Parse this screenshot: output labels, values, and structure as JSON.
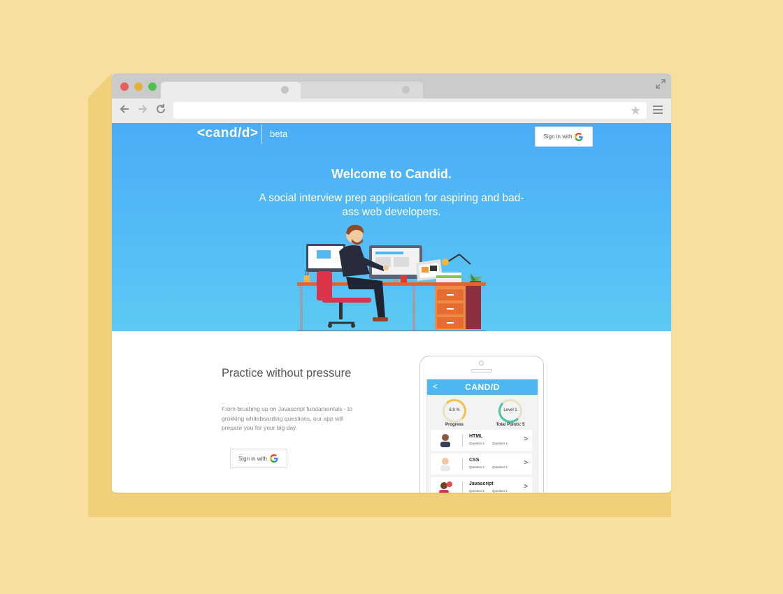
{
  "browser": {
    "dot_colors": [
      "#e5605b",
      "#e2b33c",
      "#4fc24f"
    ],
    "url": ""
  },
  "header": {
    "logo": "<cand/d>",
    "beta": "beta",
    "signin_label": "Sign in with"
  },
  "hero": {
    "title": "Welcome to Candid.",
    "subtitle": "A social interview prep application for aspiring and bad-ass web developers."
  },
  "practice": {
    "title": "Practice without pressure",
    "text": "From brushing up on Javascript fundamentals - to grokking whiteboarding questions, our app will prepare you for your big day.",
    "signin_label": "Sign in with"
  },
  "phone": {
    "app_title": "CAND/D",
    "progress_value": "6.8 %",
    "progress_caption": "Progress",
    "level_value": "Level 1",
    "points_caption": "Total Points: 5",
    "rows": [
      {
        "topic": "HTML",
        "q1": "Question 1",
        "q2": "Question 1"
      },
      {
        "topic": "CSS",
        "q1": "Question 2",
        "q2": "Question 1"
      },
      {
        "topic": "Javascript",
        "q1": "Question 5",
        "q2": "Question 1"
      }
    ]
  },
  "colors": {
    "hero_top": "#4bacf6",
    "hero_bottom": "#5ccaf4",
    "background": "#f8df9f"
  },
  "icons": [
    "expand-icon",
    "back-arrow-icon",
    "forward-arrow-icon",
    "reload-icon",
    "star-icon",
    "menu-icon",
    "google-g-icon",
    "chevron-right-icon"
  ]
}
